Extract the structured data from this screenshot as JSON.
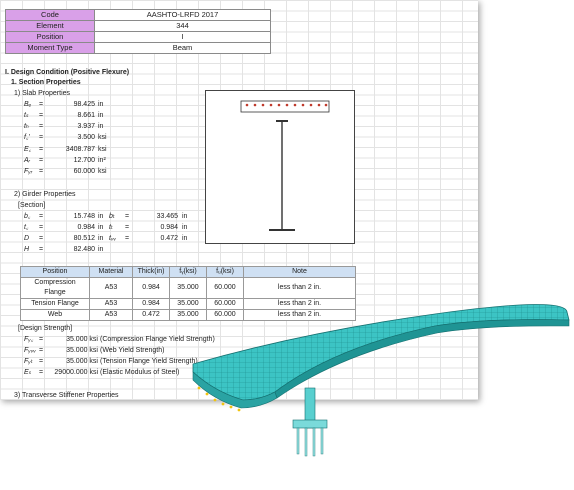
{
  "info": [
    {
      "key": "Code",
      "value": "AASHTO-LRFD 2017"
    },
    {
      "key": "Element",
      "value": "344"
    },
    {
      "key": "Position",
      "value": "I"
    },
    {
      "key": "Moment Type",
      "value": "Beam"
    }
  ],
  "headings": {
    "design_condition": "I. Design Condition (Positive Flexure)",
    "section_properties": "1. Section Properties",
    "slab_properties": "1)  Slab Properties",
    "girder_properties": "2)  Girder Properties",
    "section_label": "[Section]",
    "design_strength": "[Design Strength]",
    "transverse": "3)  Transverse Stiffener Properties"
  },
  "slab": [
    {
      "sym": "Bₑ",
      "eq": "=",
      "val": "98.425",
      "unit": "in"
    },
    {
      "sym": "tₛ",
      "eq": "=",
      "val": "8.661",
      "unit": "in"
    },
    {
      "sym": "tₕ",
      "eq": "=",
      "val": "3.937",
      "unit": "in"
    },
    {
      "sym": "f꜀'",
      "eq": "=",
      "val": "3.500",
      "unit": "ksi"
    },
    {
      "sym": "E꜀",
      "eq": "=",
      "val": "3408.787",
      "unit": "ksi"
    },
    {
      "sym": "Aᵣ",
      "eq": "=",
      "val": "12.700",
      "unit": "in²"
    },
    {
      "sym": "Fᵧᵣ",
      "eq": "=",
      "val": "60.000",
      "unit": "ksi"
    }
  ],
  "girder_left": [
    {
      "sym": "b꜀",
      "eq": "=",
      "val": "15.748",
      "unit": "in"
    },
    {
      "sym": "t꜀",
      "eq": "=",
      "val": "0.984",
      "unit": "in"
    },
    {
      "sym": "D",
      "eq": "=",
      "val": "80.512",
      "unit": "in"
    },
    {
      "sym": "H",
      "eq": "=",
      "val": "82.480",
      "unit": "in"
    }
  ],
  "girder_right": [
    {
      "sym": "bₜ",
      "eq": "=",
      "val": "33.465",
      "unit": "in"
    },
    {
      "sym": "tₜ",
      "eq": "=",
      "val": "0.984",
      "unit": "in"
    },
    {
      "sym": "tᵥᵥ",
      "eq": "=",
      "val": "0.472",
      "unit": "in"
    }
  ],
  "table": {
    "headers": [
      "Position",
      "Material",
      "Thick(in)",
      "fᵧ(ksi)",
      "fᵤ(ksi)",
      "Note"
    ],
    "rows": [
      [
        "Compression Flange",
        "A53",
        "0.984",
        "35.000",
        "60.000",
        "less than 2 in."
      ],
      [
        "Tension Flange",
        "A53",
        "0.984",
        "35.000",
        "60.000",
        "less than 2 in."
      ],
      [
        "Web",
        "A53",
        "0.472",
        "35.000",
        "60.000",
        "less than 2 in."
      ]
    ]
  },
  "strength": [
    {
      "sym": "Fᵧ꜀",
      "eq": "=",
      "val": "35.000 ksi",
      "desc": "(Compression Flange Yield Strength)"
    },
    {
      "sym": "Fᵧᵥᵥ",
      "eq": "=",
      "val": "35.000 ksi",
      "desc": "(Web Yield Strength)"
    },
    {
      "sym": "Fᵧₜ",
      "eq": "=",
      "val": "35.000 ksi",
      "desc": "(Tension Flange Yield Strength)"
    },
    {
      "sym": "Eₛ",
      "eq": "=",
      "val": "29000.000 ksi",
      "desc": "(Elastic Modulus of Steel)"
    }
  ],
  "colors": {
    "header_key_bg": "#d9a0e8",
    "table_header_bg": "#cfe0f3",
    "rebar_red": "#c0392b",
    "bridge_cyan": "#2bb8b8"
  }
}
